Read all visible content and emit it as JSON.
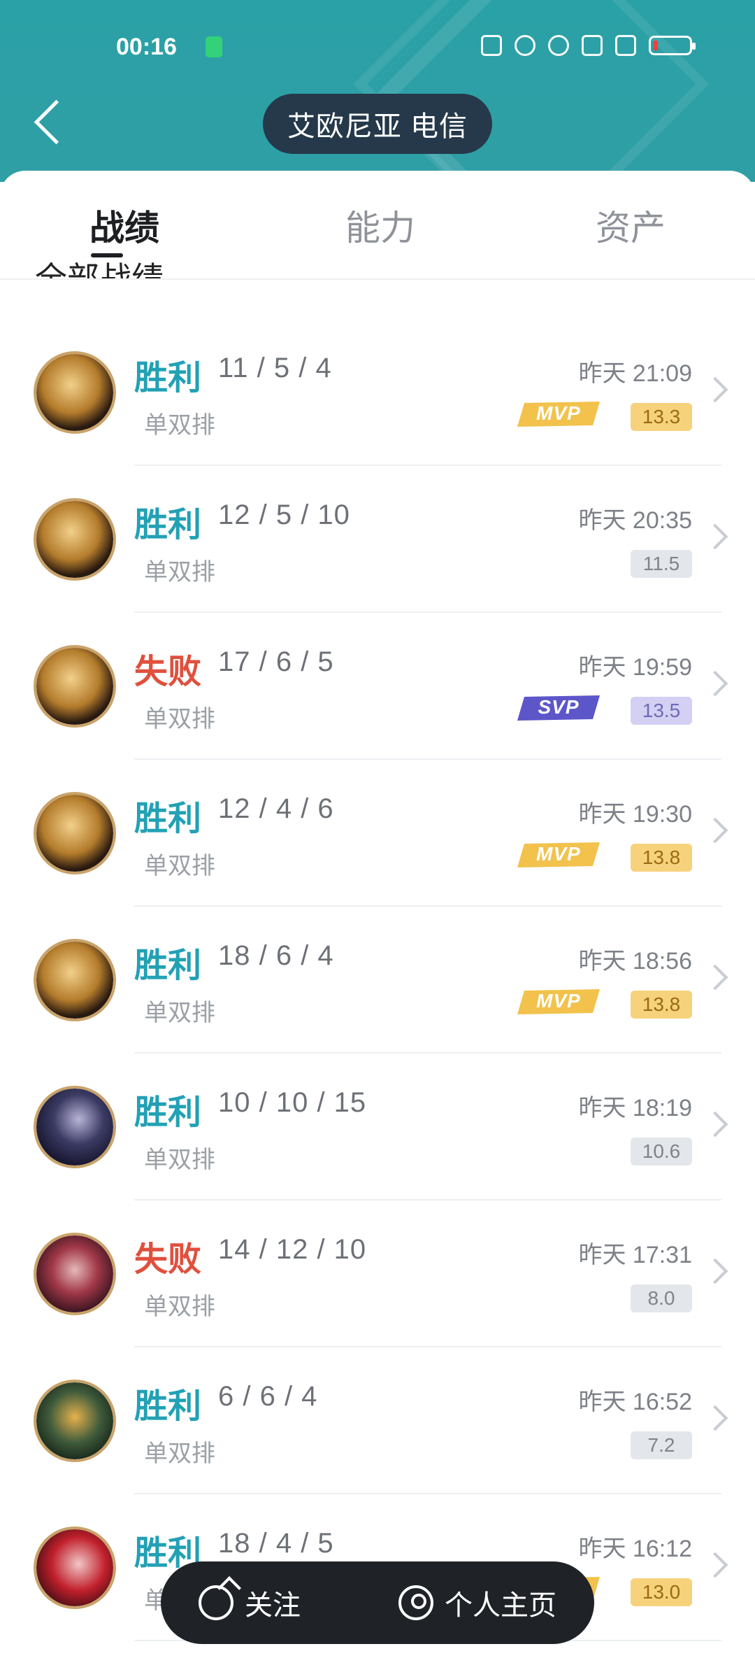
{
  "status_bar": {
    "time": "00:16",
    "icons": [
      "nfc-icon",
      "alarm-icon",
      "wifi-icon",
      "hd-icon",
      "5g-signal-icon",
      "battery-low-icon"
    ]
  },
  "header": {
    "title": "艾欧尼亚 电信"
  },
  "tabs": [
    {
      "label": "战绩",
      "active": true
    },
    {
      "label": "能力",
      "active": false
    },
    {
      "label": "资产",
      "active": false
    }
  ],
  "section": {
    "title": "全部战绩"
  },
  "matches": [
    {
      "result": "胜利",
      "kda": "11 / 5 / 4",
      "mode": "单双排",
      "time": "昨天 21:09",
      "badge": "MVP",
      "score": "13.3"
    },
    {
      "result": "胜利",
      "kda": "12 / 5 / 10",
      "mode": "单双排",
      "time": "昨天 20:35",
      "badge": "",
      "score": "11.5"
    },
    {
      "result": "失败",
      "kda": "17 / 6 / 5",
      "mode": "单双排",
      "time": "昨天 19:59",
      "badge": "SVP",
      "score": "13.5"
    },
    {
      "result": "胜利",
      "kda": "12 / 4 / 6",
      "mode": "单双排",
      "time": "昨天 19:30",
      "badge": "MVP",
      "score": "13.8"
    },
    {
      "result": "胜利",
      "kda": "18 / 6 / 4",
      "mode": "单双排",
      "time": "昨天 18:56",
      "badge": "MVP",
      "score": "13.8"
    },
    {
      "result": "胜利",
      "kda": "10 / 10 / 15",
      "mode": "单双排",
      "time": "昨天 18:19",
      "badge": "",
      "score": "10.6"
    },
    {
      "result": "失败",
      "kda": "14 / 12 / 10",
      "mode": "单双排",
      "time": "昨天 17:31",
      "badge": "",
      "score": "8.0"
    },
    {
      "result": "胜利",
      "kda": "6 / 6 / 4",
      "mode": "单双排",
      "time": "昨天 16:52",
      "badge": "",
      "score": "7.2"
    },
    {
      "result": "胜利",
      "kda": "18 / 4 / 5",
      "mode": "单双排",
      "time": "昨天 16:12",
      "badge": "MVP",
      "score": "13.0"
    }
  ],
  "bottom_bar": {
    "follow_label": "关注",
    "profile_label": "个人主页"
  },
  "colors": {
    "header_teal": "#2aa1a6",
    "win": "#22a1b5",
    "lose": "#e0503d",
    "mvp_gold": "#f2c24c",
    "svp_purple": "#5d56c9"
  }
}
